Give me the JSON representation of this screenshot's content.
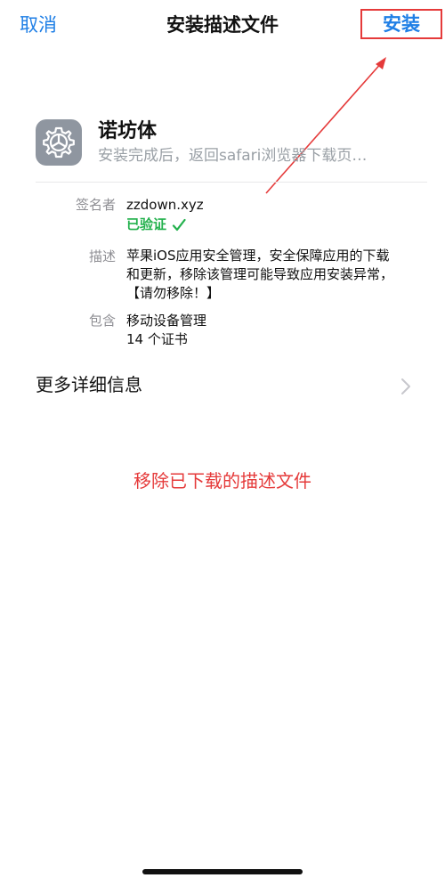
{
  "nav": {
    "cancel_label": "取消",
    "title": "安装描述文件",
    "install_label": "安装"
  },
  "profile": {
    "name": "诺坊体",
    "subtitle": "安装完成后，返回safari浏览器下载页…"
  },
  "details": {
    "signer_label": "签名者",
    "signer_value": "zzdown.xyz",
    "verified_label": "已验证",
    "description_label": "描述",
    "description_lines": [
      "苹果iOS应用安全管理，安全保障应用的下载",
      "和更新，移除该管理可能导致应用安装异常，",
      "【请勿移除！】"
    ],
    "contains_label": "包含",
    "contains_lines": [
      "移动设备管理",
      "14 个证书"
    ]
  },
  "more_info": {
    "label": "更多详细信息"
  },
  "remove": {
    "label": "移除已下载的描述文件"
  },
  "colors": {
    "accent_blue": "#1f7fe6",
    "annotation_red": "#e53a3a",
    "verified_green": "#23b14d",
    "icon_gray": "#8f96a0"
  },
  "icons": {
    "profile": "settings-gear-icon",
    "verified": "checkmark-icon",
    "more": "chevron-right-icon"
  }
}
